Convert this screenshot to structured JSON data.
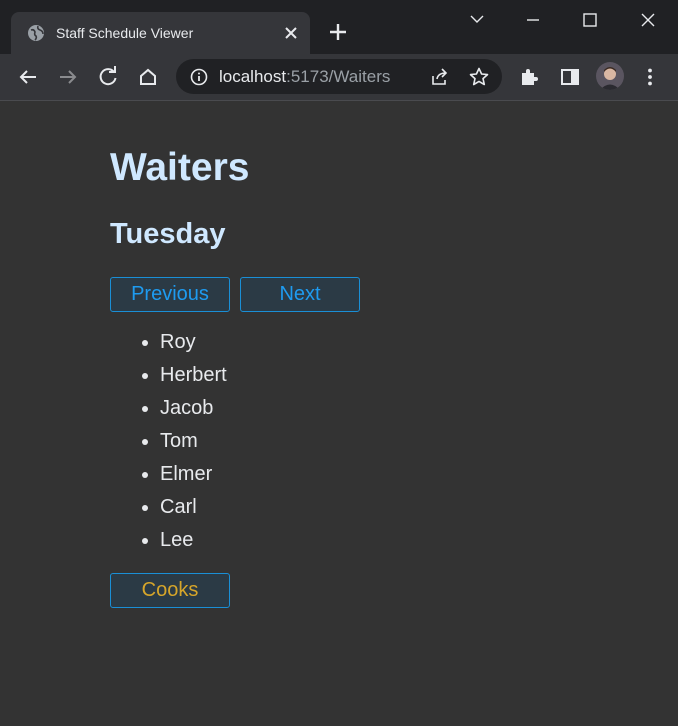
{
  "browser": {
    "tab_title": "Staff Schedule Viewer",
    "url_host": "localhost",
    "url_path": ":5173/Waiters"
  },
  "page": {
    "title": "Waiters",
    "day": "Tuesday",
    "previous_label": "Previous",
    "next_label": "Next",
    "staff": [
      "Roy",
      "Herbert",
      "Jacob",
      "Tom",
      "Elmer",
      "Carl",
      "Lee"
    ],
    "cooks_label": "Cooks"
  },
  "colors": {
    "heading": "#cfe8ff",
    "button_text": "#1e9bf0",
    "cooks_text": "#d6a52a",
    "page_bg": "#333333"
  },
  "icons": [
    "globe-icon",
    "close-icon",
    "plus-icon",
    "chevron-down-icon",
    "minimize-icon",
    "maximize-icon",
    "window-close-icon",
    "back-arrow-icon",
    "forward-arrow-icon",
    "reload-icon",
    "home-icon",
    "info-icon",
    "share-icon",
    "star-icon",
    "extensions-icon",
    "side-panel-icon",
    "more-vert-icon"
  ]
}
